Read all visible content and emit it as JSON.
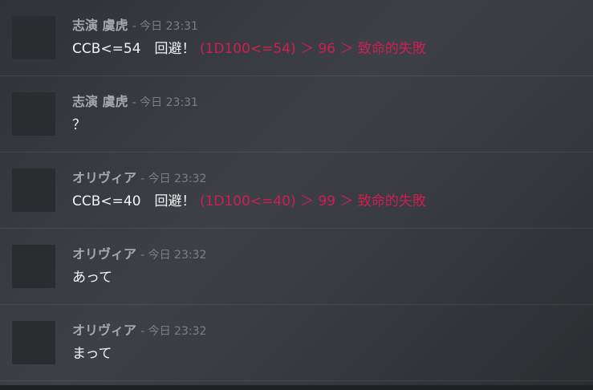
{
  "messages": [
    {
      "author": "志演 虞虎",
      "time": "- 今日 23:31",
      "text": "CCB<=54　回避！",
      "dice": "(1D100<=54) ＞ 96 ＞ 致命的失敗"
    },
    {
      "author": "志演 虞虎",
      "time": "- 今日 23:31",
      "text": "？",
      "dice": ""
    },
    {
      "author": "オリヴィア",
      "time": "- 今日 23:32",
      "text": "CCB<=40　回避！",
      "dice": "(1D100<=40) ＞ 99 ＞ 致命的失敗"
    },
    {
      "author": "オリヴィア",
      "time": "- 今日 23:32",
      "text": "あって",
      "dice": ""
    },
    {
      "author": "オリヴィア",
      "time": "- 今日 23:32",
      "text": "まって",
      "dice": ""
    }
  ],
  "colors": {
    "dice_result": "#cf1e52",
    "author_name": "#a6a8aa",
    "timestamp": "#7c7f82",
    "message_text": "#f2f3f4"
  }
}
